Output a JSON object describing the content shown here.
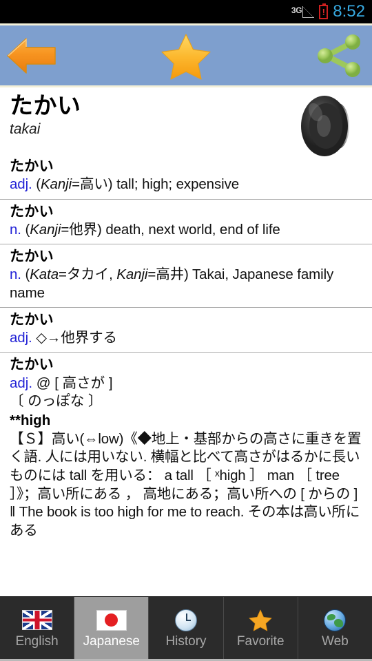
{
  "statusbar": {
    "network_label": "3G",
    "time": "8:52",
    "time_color": "#37a9e0",
    "battery_state": "!",
    "battery_color": "#cf2020"
  },
  "toolbar": {
    "background": "#7e9fce",
    "border_color": "#f2efd8",
    "back_label": "Back",
    "favorite_label": "Favorite",
    "share_label": "Share"
  },
  "headword": {
    "kana": "たかい",
    "romaji": "takai",
    "audio_label": "Pronounce"
  },
  "entries": [
    {
      "kana": "たかい",
      "pos": "adj.",
      "def_prefix": " (",
      "def_italic": "Kanji",
      "def_suffix": "=高い) tall; high; expensive"
    },
    {
      "kana": "たかい",
      "pos": "n.",
      "def_prefix": " (",
      "def_italic": "Kanji",
      "def_suffix": "=他界) death, next world, end of life"
    },
    {
      "kana": "たかい",
      "pos": "n.",
      "def_prefix": " (",
      "def_italic": "Kata",
      "def_mid": "=タカイ, ",
      "def_italic2": "Kanji",
      "def_suffix": "=高井) Takai, Japanese family name"
    },
    {
      "kana": "たかい",
      "pos": "adj.",
      "def_suffix": " ◇→他界する"
    },
    {
      "kana": "たかい",
      "pos": "adj.",
      "def_suffix": " @ [ 高さが ]",
      "line2": "〔 のっぽな 〕",
      "line3_bold": "**high",
      "body": "【Ｓ】高い(⇔low)《◆地上・基部からの高さに重きを置く語. 人には用いない. 横幅と比べて高さがはるかに長いものには tall を用いる： a tall ［ ˣhigh ］ man ［ tree ］》；高い所にある ， 高地にある；高い所への [ からの ] ‖ The book is too high for me to reach. その本は高い所にある"
    }
  ],
  "tabs": [
    {
      "label": "English",
      "icon": "uk-flag-icon",
      "selected": false
    },
    {
      "label": "Japanese",
      "icon": "japan-flag-icon",
      "selected": true
    },
    {
      "label": "History",
      "icon": "clock-icon",
      "selected": false
    },
    {
      "label": "Favorite",
      "icon": "star-icon",
      "selected": false
    },
    {
      "label": "Web",
      "icon": "globe-icon",
      "selected": false
    }
  ]
}
